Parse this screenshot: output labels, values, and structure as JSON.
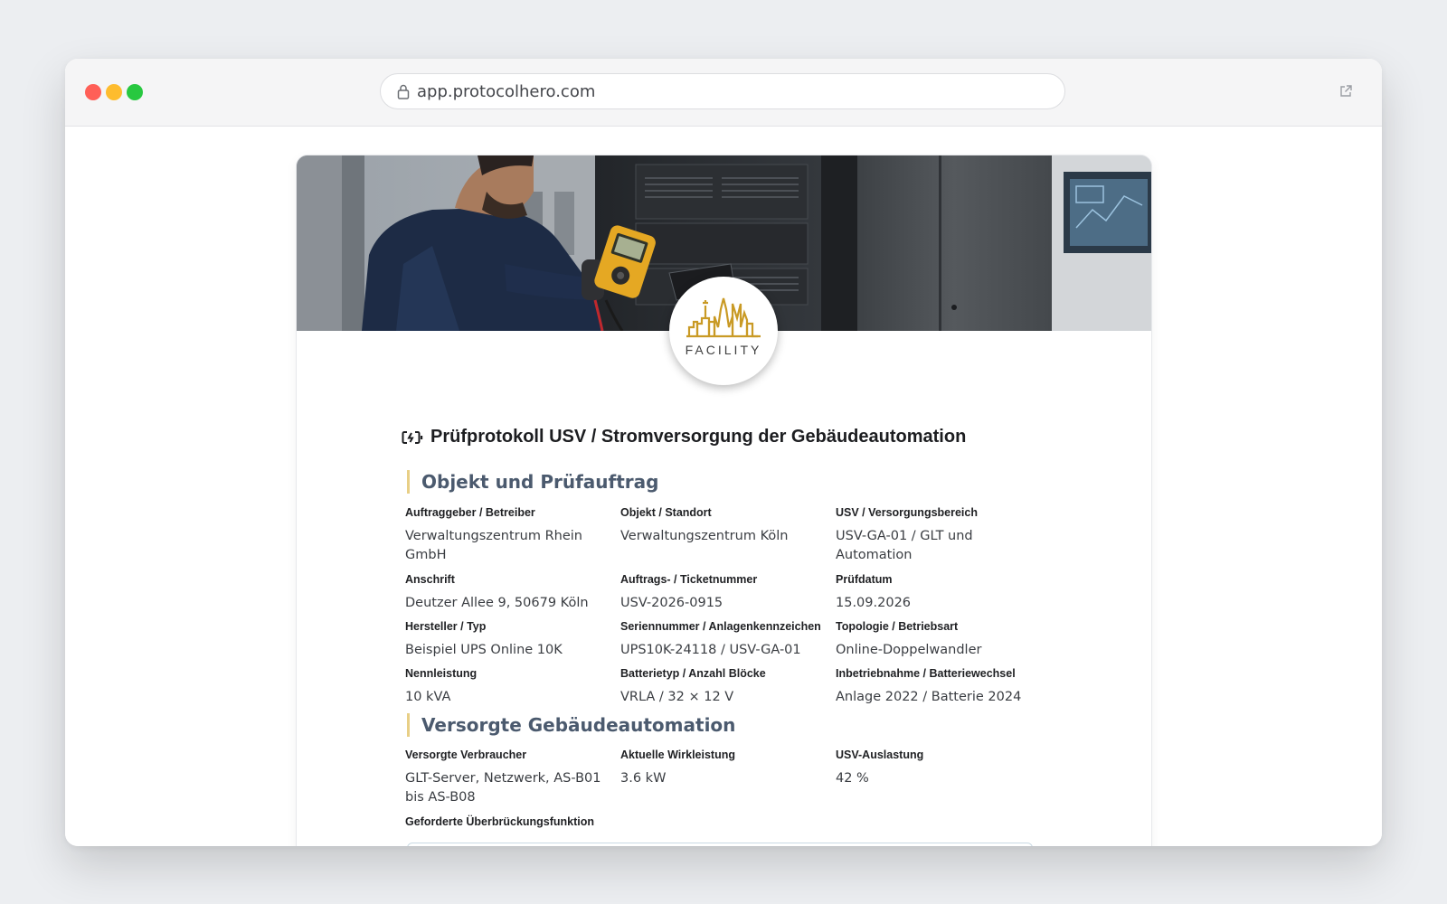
{
  "browser": {
    "url": "app.protocolhero.com"
  },
  "logo": {
    "text": "FACILITY"
  },
  "document": {
    "title": "Prüfprotokoll USV / Stromversorgung der Gebäudeautomation"
  },
  "sections": [
    {
      "heading": "Objekt und Prüfauftrag",
      "fields": [
        {
          "label": "Auftraggeber / Betreiber",
          "value": "Verwaltungszentrum Rhein GmbH"
        },
        {
          "label": "Objekt / Standort",
          "value": "Verwaltungszentrum Köln"
        },
        {
          "label": "USV / Versorgungsbereich",
          "value": "USV-GA-01 / GLT und Automation"
        },
        {
          "label": "Anschrift",
          "value": "Deutzer Allee 9, 50679 Köln"
        },
        {
          "label": "Auftrags- / Ticketnummer",
          "value": "USV-2026-0915"
        },
        {
          "label": "Prüfdatum",
          "value": "15.09.2026"
        },
        {
          "label": "Hersteller / Typ",
          "value": "Beispiel UPS Online 10K"
        },
        {
          "label": "Seriennummer / Anlagenkennzeichen",
          "value": "UPS10K-24118 / USV-GA-01"
        },
        {
          "label": "Topologie / Betriebsart",
          "value": "Online-Doppelwandler"
        },
        {
          "label": "Nennleistung",
          "value": "10 kVA"
        },
        {
          "label": "Batterietyp / Anzahl Blöcke",
          "value": "VRLA / 32 × 12 V"
        },
        {
          "label": "Inbetriebnahme / Batteriewechsel",
          "value": "Anlage 2022 / Batterie 2024"
        }
      ]
    },
    {
      "heading": "Versorgte Gebäudeautomation",
      "fields": [
        {
          "label": "Versorgte Verbraucher",
          "value": "GLT-Server, Netzwerk, AS-B01 bis AS-B08"
        },
        {
          "label": "Aktuelle Wirkleistung",
          "value": "3.6 kW"
        },
        {
          "label": "USV-Auslastung",
          "value": "42 %"
        },
        {
          "label": "Geforderte Überbrückungsfunktion",
          "value": ""
        }
      ]
    }
  ],
  "icons": {
    "lock": "lock-icon",
    "external": "external-link-icon",
    "title": "battery-charging-icon"
  }
}
